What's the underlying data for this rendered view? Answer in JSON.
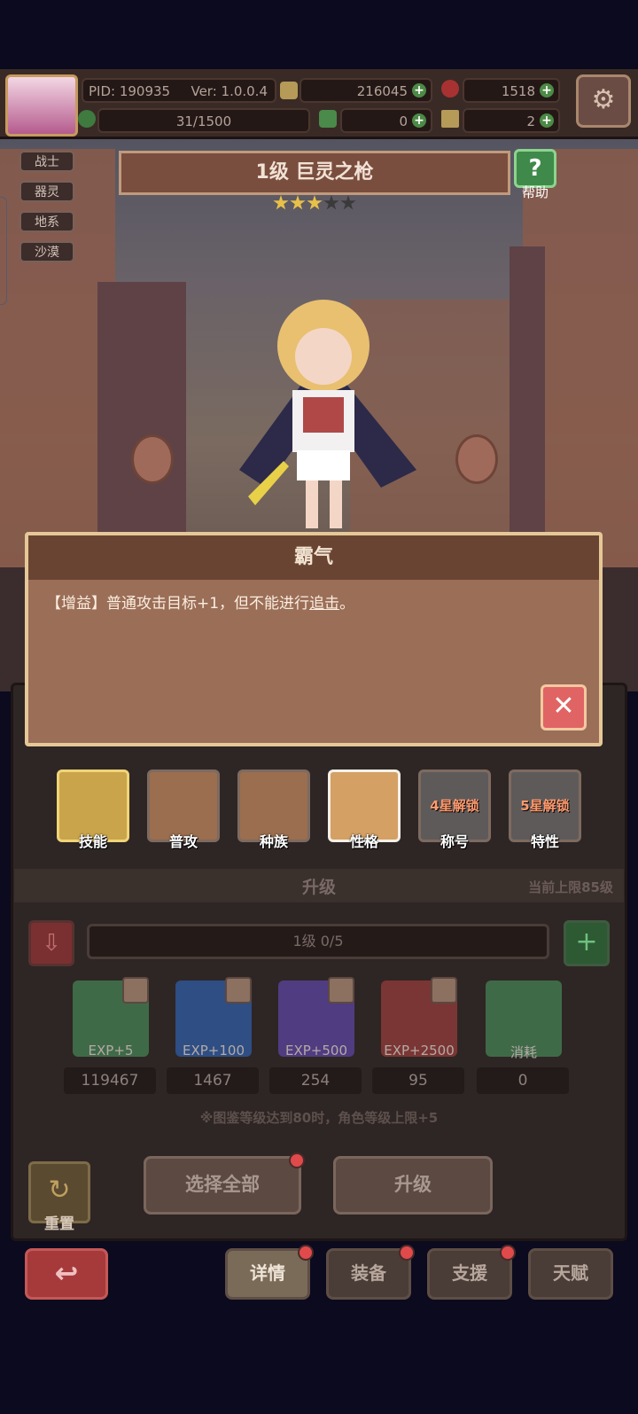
{
  "header": {
    "pid": "PID: 190935",
    "version": "Ver: 1.0.0.4",
    "gold": "216045",
    "gems": "1518",
    "stamina": "31/1500",
    "clover": "0",
    "music_note": "2"
  },
  "tags": [
    "战士",
    "器灵",
    "地系",
    "沙漠"
  ],
  "character": {
    "name": "1级  巨灵之枪",
    "stars_filled": 3,
    "stars_total": 5,
    "help_label": "帮助"
  },
  "dialog": {
    "title": "霸气",
    "text_prefix": "【增益】普通攻击目标+1，但不能进行",
    "text_link": "追击",
    "text_suffix": "。"
  },
  "tabs": [
    {
      "label": "技能"
    },
    {
      "label": "普攻"
    },
    {
      "label": "种族"
    },
    {
      "label": "性格"
    },
    {
      "label": "称号",
      "lock": "4星解锁"
    },
    {
      "label": "特性",
      "lock": "5星解锁"
    }
  ],
  "upgrade": {
    "title": "升级",
    "cap": "当前上限85级",
    "progress": "1级  0/5",
    "items": [
      {
        "label": "EXP+5",
        "count": "119467"
      },
      {
        "label": "EXP+100",
        "count": "1467"
      },
      {
        "label": "EXP+500",
        "count": "254"
      },
      {
        "label": "EXP+2500",
        "count": "95"
      },
      {
        "label": "消耗",
        "count": "0"
      }
    ],
    "note": "※图鉴等级达到80时，角色等级上限+5"
  },
  "actions": {
    "reset": "重置",
    "select_all": "选择全部",
    "upgrade": "升级"
  },
  "nav": {
    "detail": "详情",
    "equipment": "装备",
    "support": "支援",
    "talent": "天赋"
  },
  "colors": {
    "accent_green": "#4c8a46",
    "danger_red": "#e06464",
    "panel_brown": "#9b6e58"
  }
}
